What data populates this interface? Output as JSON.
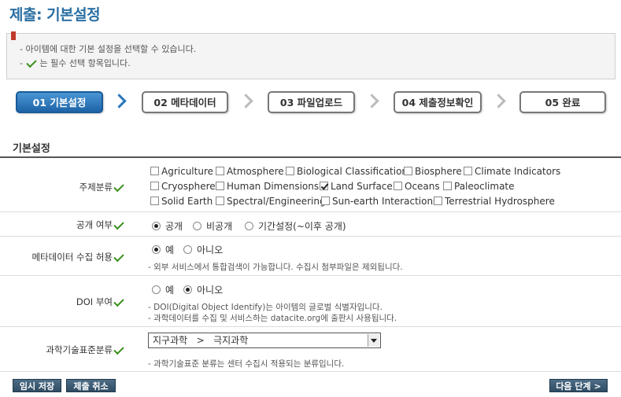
{
  "page": {
    "title": "제출: 기본설정"
  },
  "info": {
    "line1": "- 아이템에 대한 기본 설정을 선택할 수 있습니다.",
    "line2_prefix": "-",
    "line2_suffix": "는 필수 선택 항목입니다."
  },
  "steps": [
    {
      "label": "01 기본설정",
      "active": true
    },
    {
      "label": "02 메타데이터",
      "active": false
    },
    {
      "label": "03 파일업로드",
      "active": false
    },
    {
      "label": "04 제출정보확인",
      "active": false
    },
    {
      "label": "05 완료",
      "active": false
    }
  ],
  "section_title": "기본설정",
  "subject": {
    "label": "주제분류",
    "options": [
      {
        "label": "Agriculture",
        "checked": false
      },
      {
        "label": "Atmosphere",
        "checked": false
      },
      {
        "label": "Biological Classification",
        "checked": false
      },
      {
        "label": "Biosphere",
        "checked": false
      },
      {
        "label": "Climate Indicators",
        "checked": false
      },
      {
        "label": "Cryosphere",
        "checked": false
      },
      {
        "label": "Human Dimensions",
        "checked": false
      },
      {
        "label": "Land Surface",
        "checked": true
      },
      {
        "label": "Oceans",
        "checked": false
      },
      {
        "label": "Paleoclimate",
        "checked": false
      },
      {
        "label": "Solid Earth",
        "checked": false
      },
      {
        "label": "Spectral/Engineering",
        "checked": false
      },
      {
        "label": "Sun-earth Interactions",
        "checked": false
      },
      {
        "label": "Terrestrial Hydrosphere",
        "checked": false
      }
    ]
  },
  "visibility": {
    "label": "공개 여부",
    "options": [
      "공개",
      "비공개",
      "기간설정(~이후 공개)"
    ],
    "selected": 0
  },
  "metadata_harvest": {
    "label": "메타데이터 수집 허용",
    "options": [
      "예",
      "아니오"
    ],
    "selected": 0,
    "hint": "- 외부 서비스에서 통합검색이 가능합니다. 수집시 첨부파일은 제외됩니다."
  },
  "doi": {
    "label": "DOI 부여",
    "options": [
      "예",
      "아니오"
    ],
    "selected": 1,
    "hint1": "- DOI(Digital Object Identify)는 아이템의 글로벌 식별자입니다.",
    "hint2": "- 과학데이터를 수집 및 서비스하는 datacite.org에 출판시 사용됩니다."
  },
  "standard_class": {
    "label": "과학기술표준분류",
    "value": "지구과학   >   극지과학",
    "hint": "- 과학기술표준 분류는 센터 수집시 적용되는 분류입니다."
  },
  "buttons": {
    "temp_save": "임시 저장",
    "cancel": "제출 취소",
    "next": "다음 단계 >"
  },
  "colors": {
    "accent": "#2a6fa3",
    "required_check": "#3a8f1d",
    "button": "#3b5870"
  }
}
